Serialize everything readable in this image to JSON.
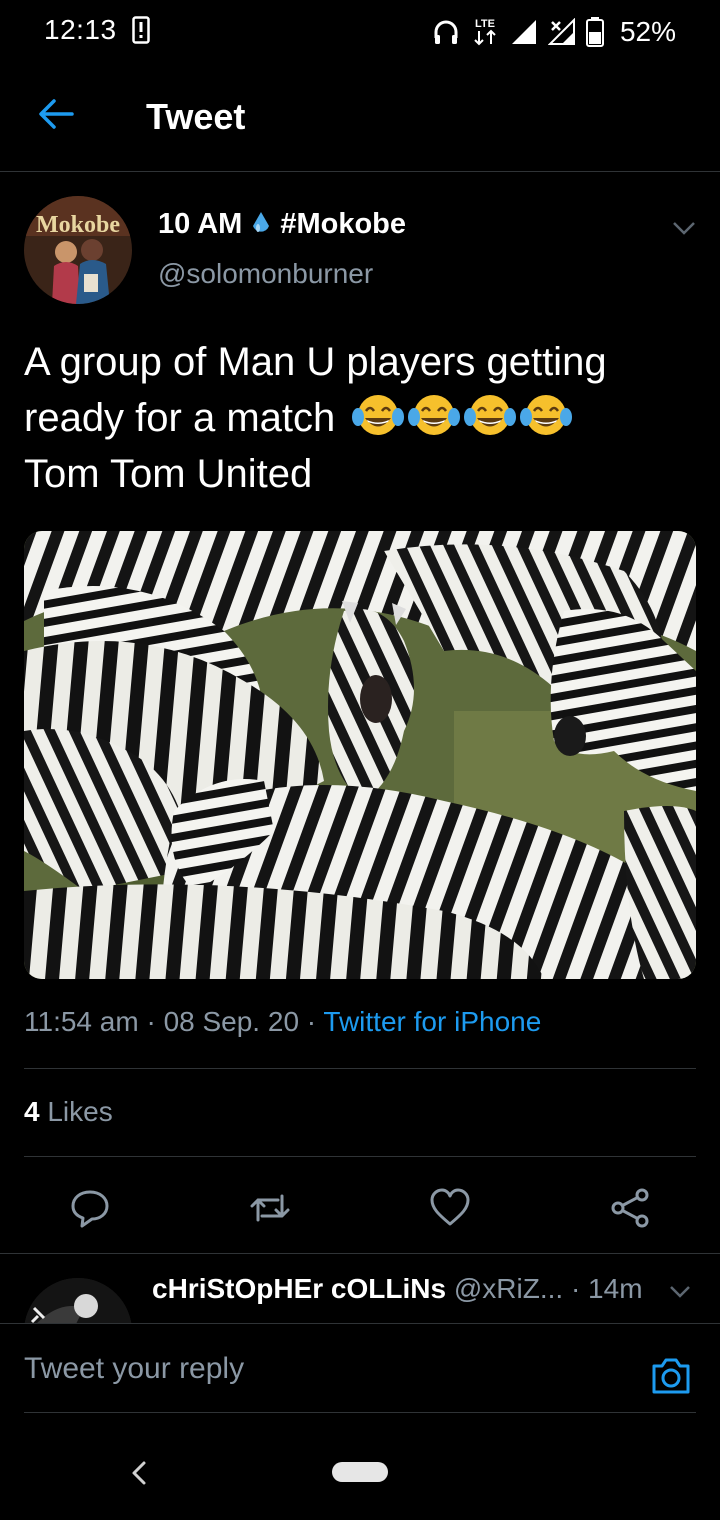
{
  "status_bar": {
    "time": "12:13",
    "network_label": "LTE",
    "battery_percent": "52%"
  },
  "header": {
    "title": "Tweet"
  },
  "tweet": {
    "display_name": "10 AM",
    "hashtag": "#Mokobe",
    "handle": "@solomonburner",
    "text_line1": "A group of Man U players getting",
    "text_line2": "ready for a match",
    "text_line3": "Tom Tom United",
    "emoji": "😂😂😂😂",
    "time": "11:54 am",
    "date": "08 Sep. 20",
    "source": "Twitter for iPhone",
    "likes_count": "4",
    "likes_label": "Likes"
  },
  "reply": {
    "name": "cHriStOpHEr cOLLiNs",
    "handle": "@xRiZ...",
    "time": "14m"
  },
  "composer": {
    "placeholder": "Tweet your reply"
  },
  "colors": {
    "background": "#000000",
    "accent": "#1d9bf0",
    "secondary_text": "#8b98a5",
    "divider": "#2f3336"
  },
  "icons": {
    "back": "arrow-left-icon",
    "drop": "water-drop-icon",
    "reply": "speech-bubble-icon",
    "retweet": "retweet-icon",
    "like": "heart-icon",
    "share": "share-icon",
    "camera": "camera-icon"
  }
}
